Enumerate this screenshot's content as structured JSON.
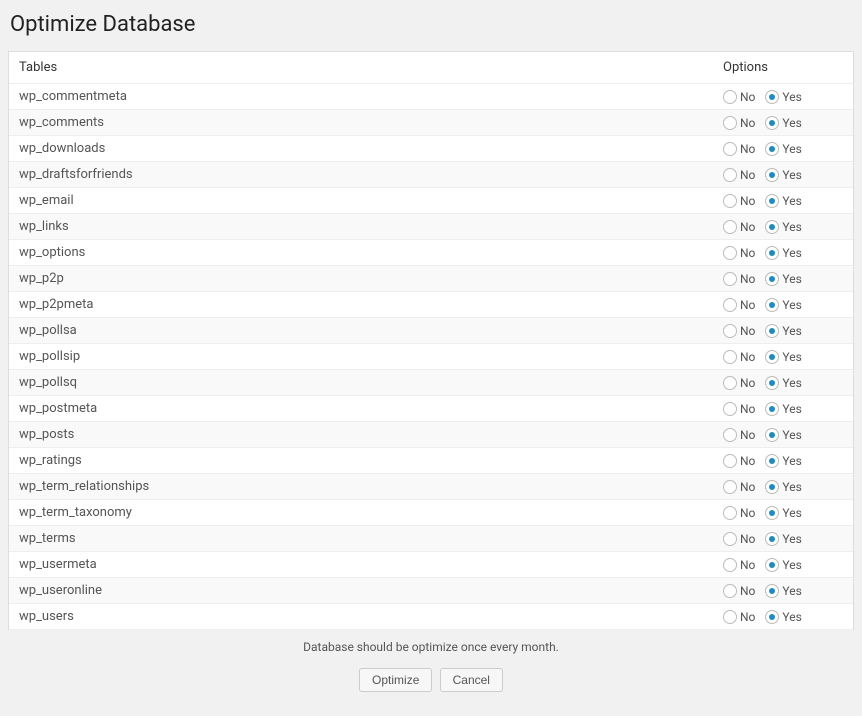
{
  "page": {
    "title": "Optimize Database"
  },
  "headers": {
    "tables": "Tables",
    "options": "Options"
  },
  "labels": {
    "no": "No",
    "yes": "Yes"
  },
  "rows": [
    {
      "name": "wp_commentmeta",
      "selected": "yes"
    },
    {
      "name": "wp_comments",
      "selected": "yes"
    },
    {
      "name": "wp_downloads",
      "selected": "yes"
    },
    {
      "name": "wp_draftsforfriends",
      "selected": "yes"
    },
    {
      "name": "wp_email",
      "selected": "yes"
    },
    {
      "name": "wp_links",
      "selected": "yes"
    },
    {
      "name": "wp_options",
      "selected": "yes"
    },
    {
      "name": "wp_p2p",
      "selected": "yes"
    },
    {
      "name": "wp_p2pmeta",
      "selected": "yes"
    },
    {
      "name": "wp_pollsa",
      "selected": "yes"
    },
    {
      "name": "wp_pollsip",
      "selected": "yes"
    },
    {
      "name": "wp_pollsq",
      "selected": "yes"
    },
    {
      "name": "wp_postmeta",
      "selected": "yes"
    },
    {
      "name": "wp_posts",
      "selected": "yes"
    },
    {
      "name": "wp_ratings",
      "selected": "yes"
    },
    {
      "name": "wp_term_relationships",
      "selected": "yes"
    },
    {
      "name": "wp_term_taxonomy",
      "selected": "yes"
    },
    {
      "name": "wp_terms",
      "selected": "yes"
    },
    {
      "name": "wp_usermeta",
      "selected": "yes"
    },
    {
      "name": "wp_useronline",
      "selected": "yes"
    },
    {
      "name": "wp_users",
      "selected": "yes"
    }
  ],
  "footer": {
    "note": "Database should be optimize once every month.",
    "optimize": "Optimize",
    "cancel": "Cancel"
  }
}
